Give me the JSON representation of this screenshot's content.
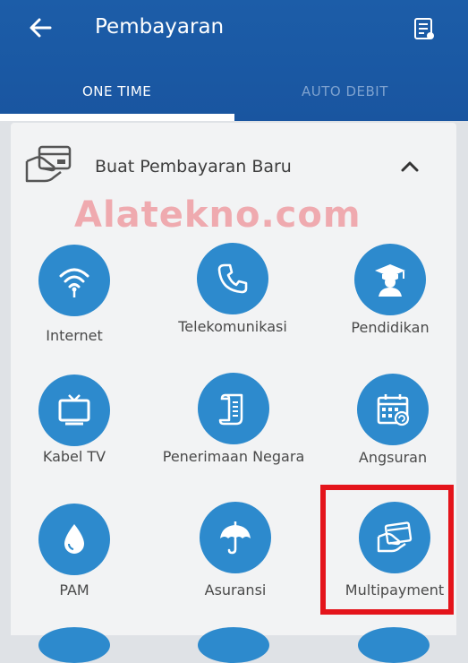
{
  "header": {
    "title": "Pembayaran",
    "back_icon": "back-arrow-icon",
    "menu_icon": "document-icon"
  },
  "tabs": [
    {
      "label": "ONE TIME",
      "active": true
    },
    {
      "label": "AUTO DEBIT",
      "active": false
    }
  ],
  "section": {
    "title": "Buat Pembayaran Baru",
    "icon": "hand-card-icon",
    "collapse_icon": "chevron-up-icon"
  },
  "watermark": "Alatekno.com",
  "items": [
    {
      "label": "Internet",
      "icon": "wifi-icon"
    },
    {
      "label": "Telekomunikasi",
      "icon": "phone-icon"
    },
    {
      "label": "Pendidikan",
      "icon": "graduate-icon"
    },
    {
      "label": "Kabel TV",
      "icon": "tv-icon"
    },
    {
      "label": "Penerimaan Negara",
      "icon": "scroll-icon"
    },
    {
      "label": "Angsuran",
      "icon": "calendar-icon"
    },
    {
      "label": "PAM",
      "icon": "water-drop-icon"
    },
    {
      "label": "Asuransi",
      "icon": "umbrella-icon"
    },
    {
      "label": "Multipayment",
      "icon": "card-hand-icon"
    }
  ],
  "colors": {
    "appbar": "#1c5da8",
    "icon_circle": "#2d8acd",
    "highlight": "#e4141b",
    "watermark": "#ec6e76"
  }
}
